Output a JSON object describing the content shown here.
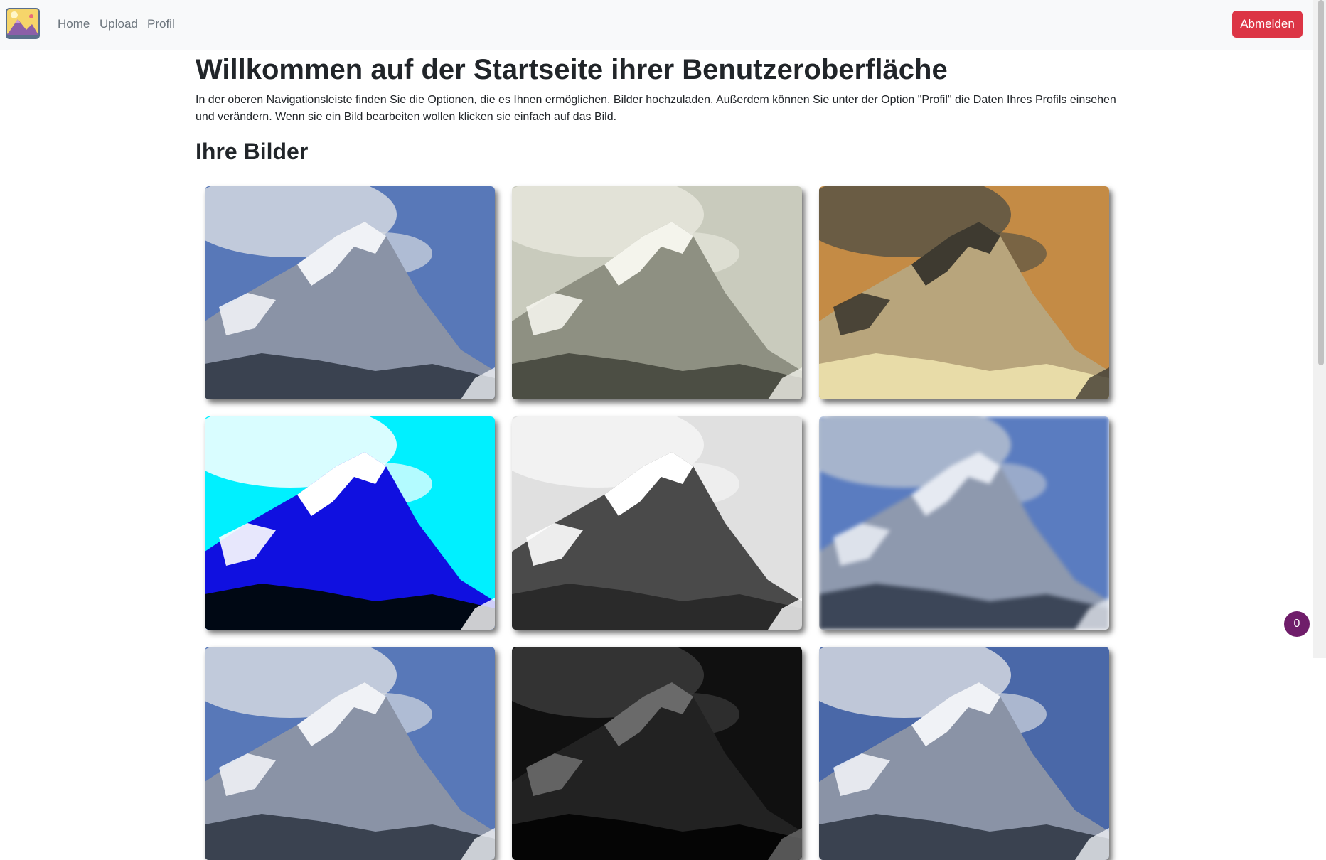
{
  "nav": {
    "items": [
      {
        "label": "Home",
        "active": true
      },
      {
        "label": "Upload",
        "active": false
      },
      {
        "label": "Profil",
        "active": false
      }
    ],
    "logout_label": "Abmelden"
  },
  "main": {
    "title": "Willkommen auf der Startseite ihrer Benutzeroberfläche",
    "intro": "In der oberen Navigationsleiste finden Sie die Optionen, die es Ihnen ermöglichen, Bilder hochzuladen. Außerdem können Sie unter der Option \"Profil\" die Daten Ihres Profils einsehen und verändern. Wenn sie ein Bild bearbeiten wollen klicken sie einfach auf das Bild.",
    "gallery_title": "Ihre Bilder"
  },
  "gallery": [
    {
      "filter": "original",
      "sky": "#5878b8",
      "cloud": "#d4d8e0",
      "rock": "#8a93a6",
      "snow": "#f0f2f6",
      "base": "#3a4250"
    },
    {
      "filter": "sepia-light",
      "sky": "#c9cbbd",
      "cloud": "#e6e6dc",
      "rock": "#8e9082",
      "snow": "#f4f4ec",
      "base": "#4c4e44"
    },
    {
      "filter": "inverted",
      "sky": "#c48b45",
      "cloud": "#5a5444",
      "rock": "#b8a57c",
      "snow": "#3e3a30",
      "base": "#e8dca8"
    },
    {
      "filter": "high-contrast",
      "sky": "#00f0ff",
      "cloud": "#ffffff",
      "rock": "#1010e0",
      "snow": "#ffffff",
      "base": "#000814"
    },
    {
      "filter": "grayscale",
      "sky": "#e0e0e0",
      "cloud": "#f4f4f4",
      "rock": "#4a4a4a",
      "snow": "#ffffff",
      "base": "#2a2a2a"
    },
    {
      "filter": "blur",
      "sky": "#5a7cc0",
      "cloud": "#b4bece",
      "rock": "#8e99ae",
      "snow": "#e6eaf2",
      "base": "#3c4658"
    },
    {
      "filter": "original",
      "sky": "#5878b8",
      "cloud": "#d4d8e0",
      "rock": "#8a93a6",
      "snow": "#f0f2f6",
      "base": "#3a4250"
    },
    {
      "filter": "dark",
      "sky": "#101010",
      "cloud": "#3a3a3a",
      "rock": "#222222",
      "snow": "#6a6a6a",
      "base": "#050505"
    },
    {
      "filter": "original",
      "sky": "#4a68a8",
      "cloud": "#d4d8e0",
      "rock": "#8a93a6",
      "snow": "#f0f2f6",
      "base": "#3a4250"
    }
  ],
  "notification_count": "0"
}
